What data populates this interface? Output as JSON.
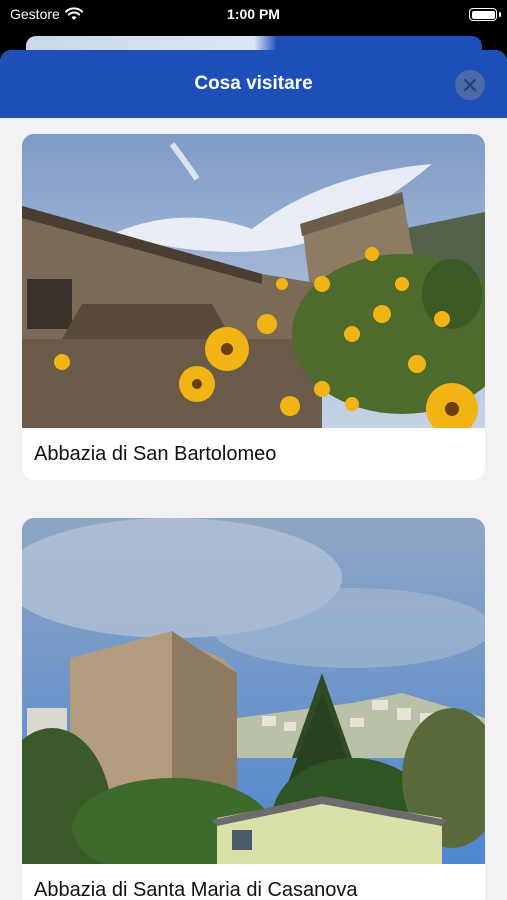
{
  "status_bar": {
    "carrier": "Gestore",
    "time": "1:00 PM",
    "icons": [
      "wifi-icon",
      "battery-icon"
    ]
  },
  "sheet": {
    "title": "Cosa visitare",
    "close_icon": "close-icon"
  },
  "places": [
    {
      "name": "Abbazia di San Bartolomeo"
    },
    {
      "name": "Abbazia di Santa Maria di Casanova"
    }
  ],
  "colors": {
    "header": "#1e4fb8",
    "sheet_background": "#f2f2f4",
    "card_background": "#ffffff"
  }
}
